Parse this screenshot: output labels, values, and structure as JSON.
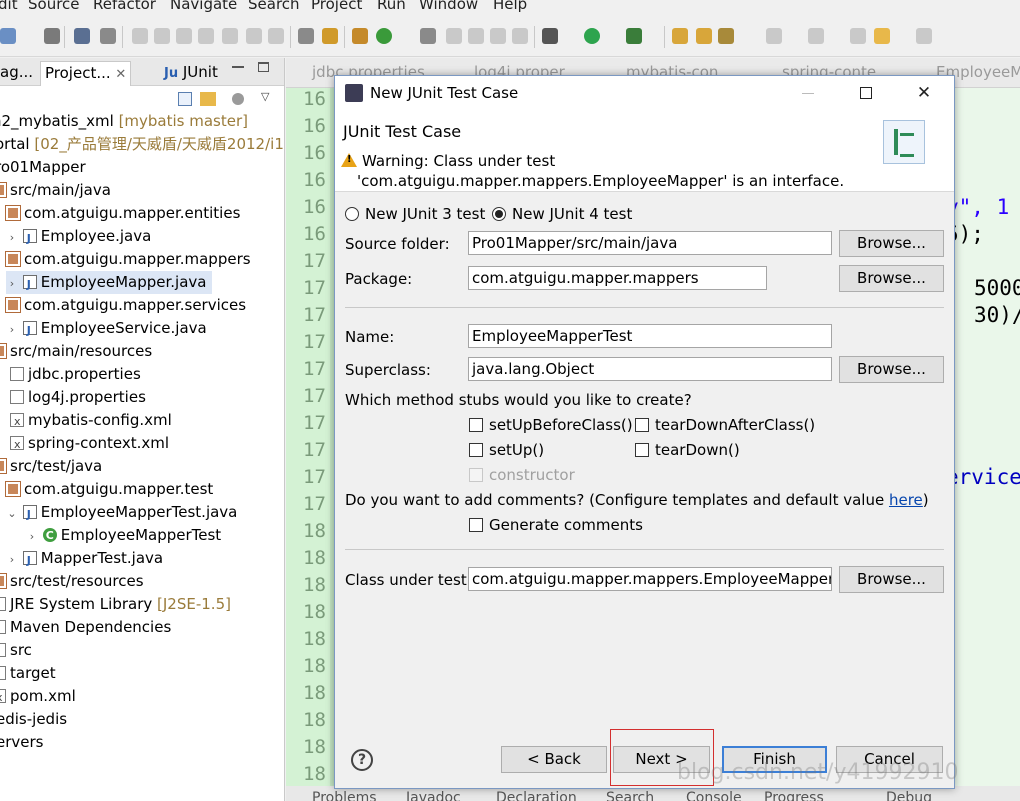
{
  "menu": [
    "dit",
    "Source",
    "Refactor",
    "Navigate",
    "Search",
    "Project",
    "Run",
    "Window",
    "Help"
  ],
  "views": {
    "tabs": [
      "ag...",
      "Project...",
      "JUnit"
    ],
    "tree": [
      {
        "label": "n2_mybatis_xml",
        "extra": "[mybatis master]"
      },
      {
        "label": "ortal",
        "extra": "[02_产品管理/天威盾/天威盾2012/i1"
      },
      {
        "label": "ro01Mapper",
        "extra": ""
      },
      {
        "label": "src/main/java",
        "extra": ""
      },
      {
        "label": "com.atguigu.mapper.entities",
        "extra": ""
      },
      {
        "label": "Employee.java",
        "extra": ""
      },
      {
        "label": "com.atguigu.mapper.mappers",
        "extra": ""
      },
      {
        "label": "EmployeeMapper.java",
        "extra": ""
      },
      {
        "label": "com.atguigu.mapper.services",
        "extra": ""
      },
      {
        "label": "EmployeeService.java",
        "extra": ""
      },
      {
        "label": "src/main/resources",
        "extra": ""
      },
      {
        "label": "jdbc.properties",
        "extra": ""
      },
      {
        "label": "log4j.properties",
        "extra": ""
      },
      {
        "label": "mybatis-config.xml",
        "extra": ""
      },
      {
        "label": "spring-context.xml",
        "extra": ""
      },
      {
        "label": "src/test/java",
        "extra": ""
      },
      {
        "label": "com.atguigu.mapper.test",
        "extra": ""
      },
      {
        "label": "EmployeeMapperTest.java",
        "extra": ""
      },
      {
        "label": "EmployeeMapperTest",
        "extra": ""
      },
      {
        "label": "MapperTest.java",
        "extra": ""
      },
      {
        "label": "src/test/resources",
        "extra": ""
      },
      {
        "label": "JRE System Library",
        "extra": "[J2SE-1.5]"
      },
      {
        "label": "Maven Dependencies",
        "extra": ""
      },
      {
        "label": "src",
        "extra": ""
      },
      {
        "label": "target",
        "extra": ""
      },
      {
        "label": "pom.xml",
        "extra": ""
      },
      {
        "label": "edis-jedis",
        "extra": ""
      },
      {
        "label": "ervers",
        "extra": ""
      }
    ]
  },
  "editor": {
    "tabs": [
      "jdbc.properties",
      "log4j.proper",
      "mybatis-con",
      "spring-conte",
      "EmployeeM"
    ],
    "line_numbers": [
      "16",
      "16",
      "16",
      "16",
      "16",
      "16",
      "17",
      "17",
      "17",
      "17",
      "17",
      "17",
      "17",
      "17",
      "17",
      "17",
      "18",
      "18",
      "18",
      "18",
      "18",
      "18",
      "18",
      "18",
      "18",
      "18"
    ],
    "fragments": [
      "y\", 1",
      "5);",
      "5000",
      "30)/",
      "ervice"
    ]
  },
  "bottom_tabs": [
    "Problems",
    "Javadoc",
    "Declaration",
    "Search",
    "Console",
    "Progress",
    "Debug"
  ],
  "dialog": {
    "title": "New JUnit Test Case",
    "header_title": "JUnit Test Case",
    "warning_line1": "Warning: Class under test",
    "warning_line2": "'com.atguigu.mapper.mappers.EmployeeMapper' is an interface.",
    "radio_junit3": "New JUnit 3 test",
    "radio_junit4": "New JUnit 4 test",
    "source_folder_label": "Source folder:",
    "source_folder_value": "Pro01Mapper/src/main/java",
    "package_label": "Package:",
    "package_value": "com.atguigu.mapper.mappers",
    "name_label": "Name:",
    "name_value": "EmployeeMapperTest",
    "superclass_label": "Superclass:",
    "superclass_value": "java.lang.Object",
    "stubs_question": "Which method stubs would you like to create?",
    "stub_setUpBeforeClass": "setUpBeforeClass()",
    "stub_tearDownAfterClass": "tearDownAfterClass()",
    "stub_setUp": "setUp()",
    "stub_tearDown": "tearDown()",
    "stub_constructor": "constructor",
    "comments_question": "Do you want to add comments? (Configure templates and default value ",
    "comments_link": "here",
    "comments_close": ")",
    "generate_comments": "Generate comments",
    "class_under_test_label": "Class under test:",
    "class_under_test_value": "com.atguigu.mapper.mappers.EmployeeMapper",
    "browse": "Browse...",
    "back": "< Back",
    "next": "Next >",
    "finish": "Finish",
    "cancel": "Cancel",
    "help_symbol": "?"
  },
  "watermark": "blog.csdn.net/y41992910"
}
